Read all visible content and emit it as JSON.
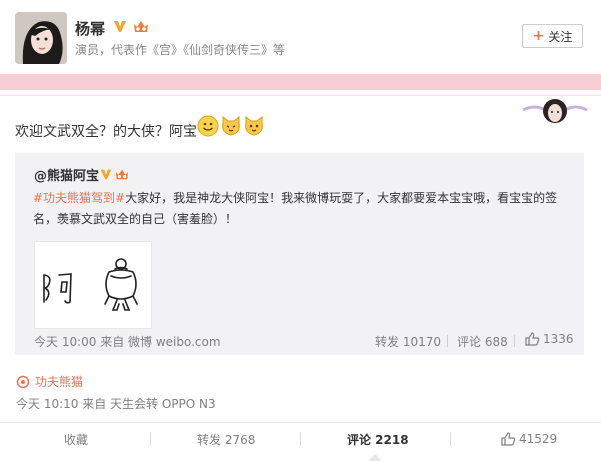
{
  "header": {
    "username": "杨幂",
    "intro": "演员，代表作《宫》《仙剑奇侠传三》等",
    "follow_label": "关注"
  },
  "post": {
    "text": "欢迎文武双全？的大侠？阿宝",
    "emoji": [
      "smile-emoji",
      "cat-emoji",
      "cat-emoji"
    ]
  },
  "repost": {
    "user": "@熊猫阿宝",
    "tag": "#功夫熊猫驾到#",
    "text": "大家好，我是神龙大侠阿宝！我来微博玩耍了，大家都要爱本宝宝哦，看宝宝的签名，羡慕文武双全的自己（害羞脸）！",
    "time": "今天 10:00 来自 微博 weibo.com",
    "forward": "转发 10170",
    "comment": "评论 688",
    "likes": "1336"
  },
  "source": {
    "label": "功夫熊猫",
    "time": "今天 10:10 来自 天生会转 OPPO N3"
  },
  "actions": {
    "favorite": "收藏",
    "forward": "转发 2768",
    "comment": "评论 2218",
    "likes": "41529"
  },
  "colors": {
    "accent": "#eb7350",
    "pink_band": "#f8cdd6",
    "repost_bg": "#f2f2f5"
  }
}
